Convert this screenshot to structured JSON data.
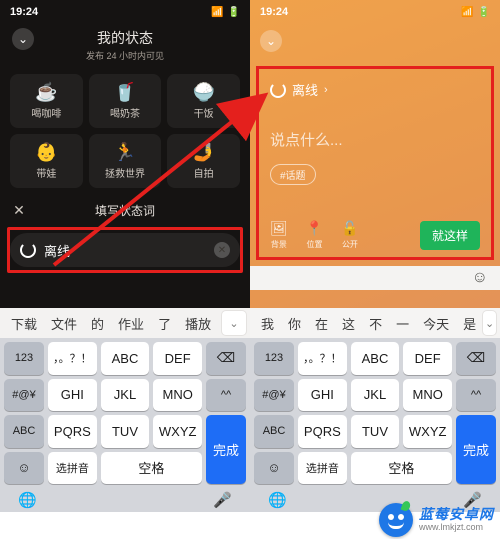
{
  "statusbar": {
    "time": "19:24"
  },
  "left": {
    "title": "我的状态",
    "subtitle": "发布 24 小时内可见",
    "grid": [
      {
        "icon": "☕",
        "label": "喝咖啡"
      },
      {
        "icon": "🥤",
        "label": "喝奶茶"
      },
      {
        "icon": "🍚",
        "label": "干饭"
      },
      {
        "icon": "👶",
        "label": "带娃"
      },
      {
        "icon": "🏃",
        "label": "拯救世界"
      },
      {
        "icon": "🤳",
        "label": "自拍"
      }
    ],
    "custom_label": "填写状态词",
    "input_value": "离线"
  },
  "right": {
    "header_text": "离线",
    "placeholder": "说点什么...",
    "tag": "#话题",
    "options": [
      {
        "icon": "🖼",
        "label": "背景"
      },
      {
        "icon": "📍",
        "label": "位置"
      },
      {
        "icon": "🔓",
        "label": "公开"
      }
    ],
    "confirm": "就这样"
  },
  "suggestions_left": [
    "下载",
    "文件",
    "的",
    "作业",
    "了",
    "播放"
  ],
  "suggestions_right": [
    "我",
    "你",
    "在",
    "这",
    "不",
    "一",
    "今天",
    "是"
  ],
  "keyboard": {
    "r1": [
      "123",
      "，。？！",
      "ABC",
      "DEF"
    ],
    "r2": [
      "#@¥",
      "GHI",
      "JKL",
      "MNO"
    ],
    "r3": [
      "ABC",
      "PQRS",
      "TUV",
      "WXYZ"
    ],
    "r4_pinyin": "选拼音",
    "r4_space": "空格",
    "done": "完成",
    "caret": "^^"
  },
  "watermark": {
    "title": "蓝莓安卓网",
    "url": "www.lmkjzt.com"
  }
}
